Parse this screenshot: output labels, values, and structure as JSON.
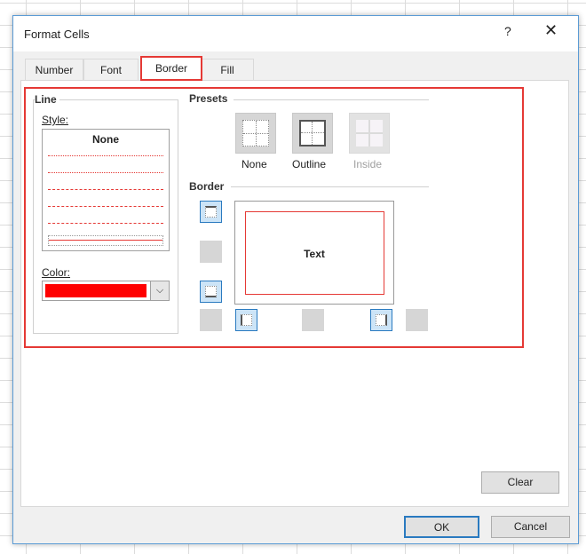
{
  "dialog": {
    "title": "Format Cells",
    "help": "?",
    "close": "✕"
  },
  "tabs": [
    {
      "label": "Number"
    },
    {
      "label": "Font"
    },
    {
      "label": "Border",
      "active": true
    },
    {
      "label": "Fill"
    }
  ],
  "line": {
    "group": "Line",
    "style_label": "Style:",
    "style_none": "None",
    "color_label": "Color:",
    "color_value": "#ff0000"
  },
  "presets": {
    "label": "Presets",
    "items": [
      {
        "label": "None"
      },
      {
        "label": "Outline"
      },
      {
        "label": "Inside",
        "disabled": true
      }
    ]
  },
  "border": {
    "label": "Border",
    "preview_text": "Text",
    "line_color": "#e53935"
  },
  "buttons": {
    "clear": "Clear",
    "ok": "OK",
    "cancel": "Cancel"
  },
  "highlight_color": "#e53935"
}
